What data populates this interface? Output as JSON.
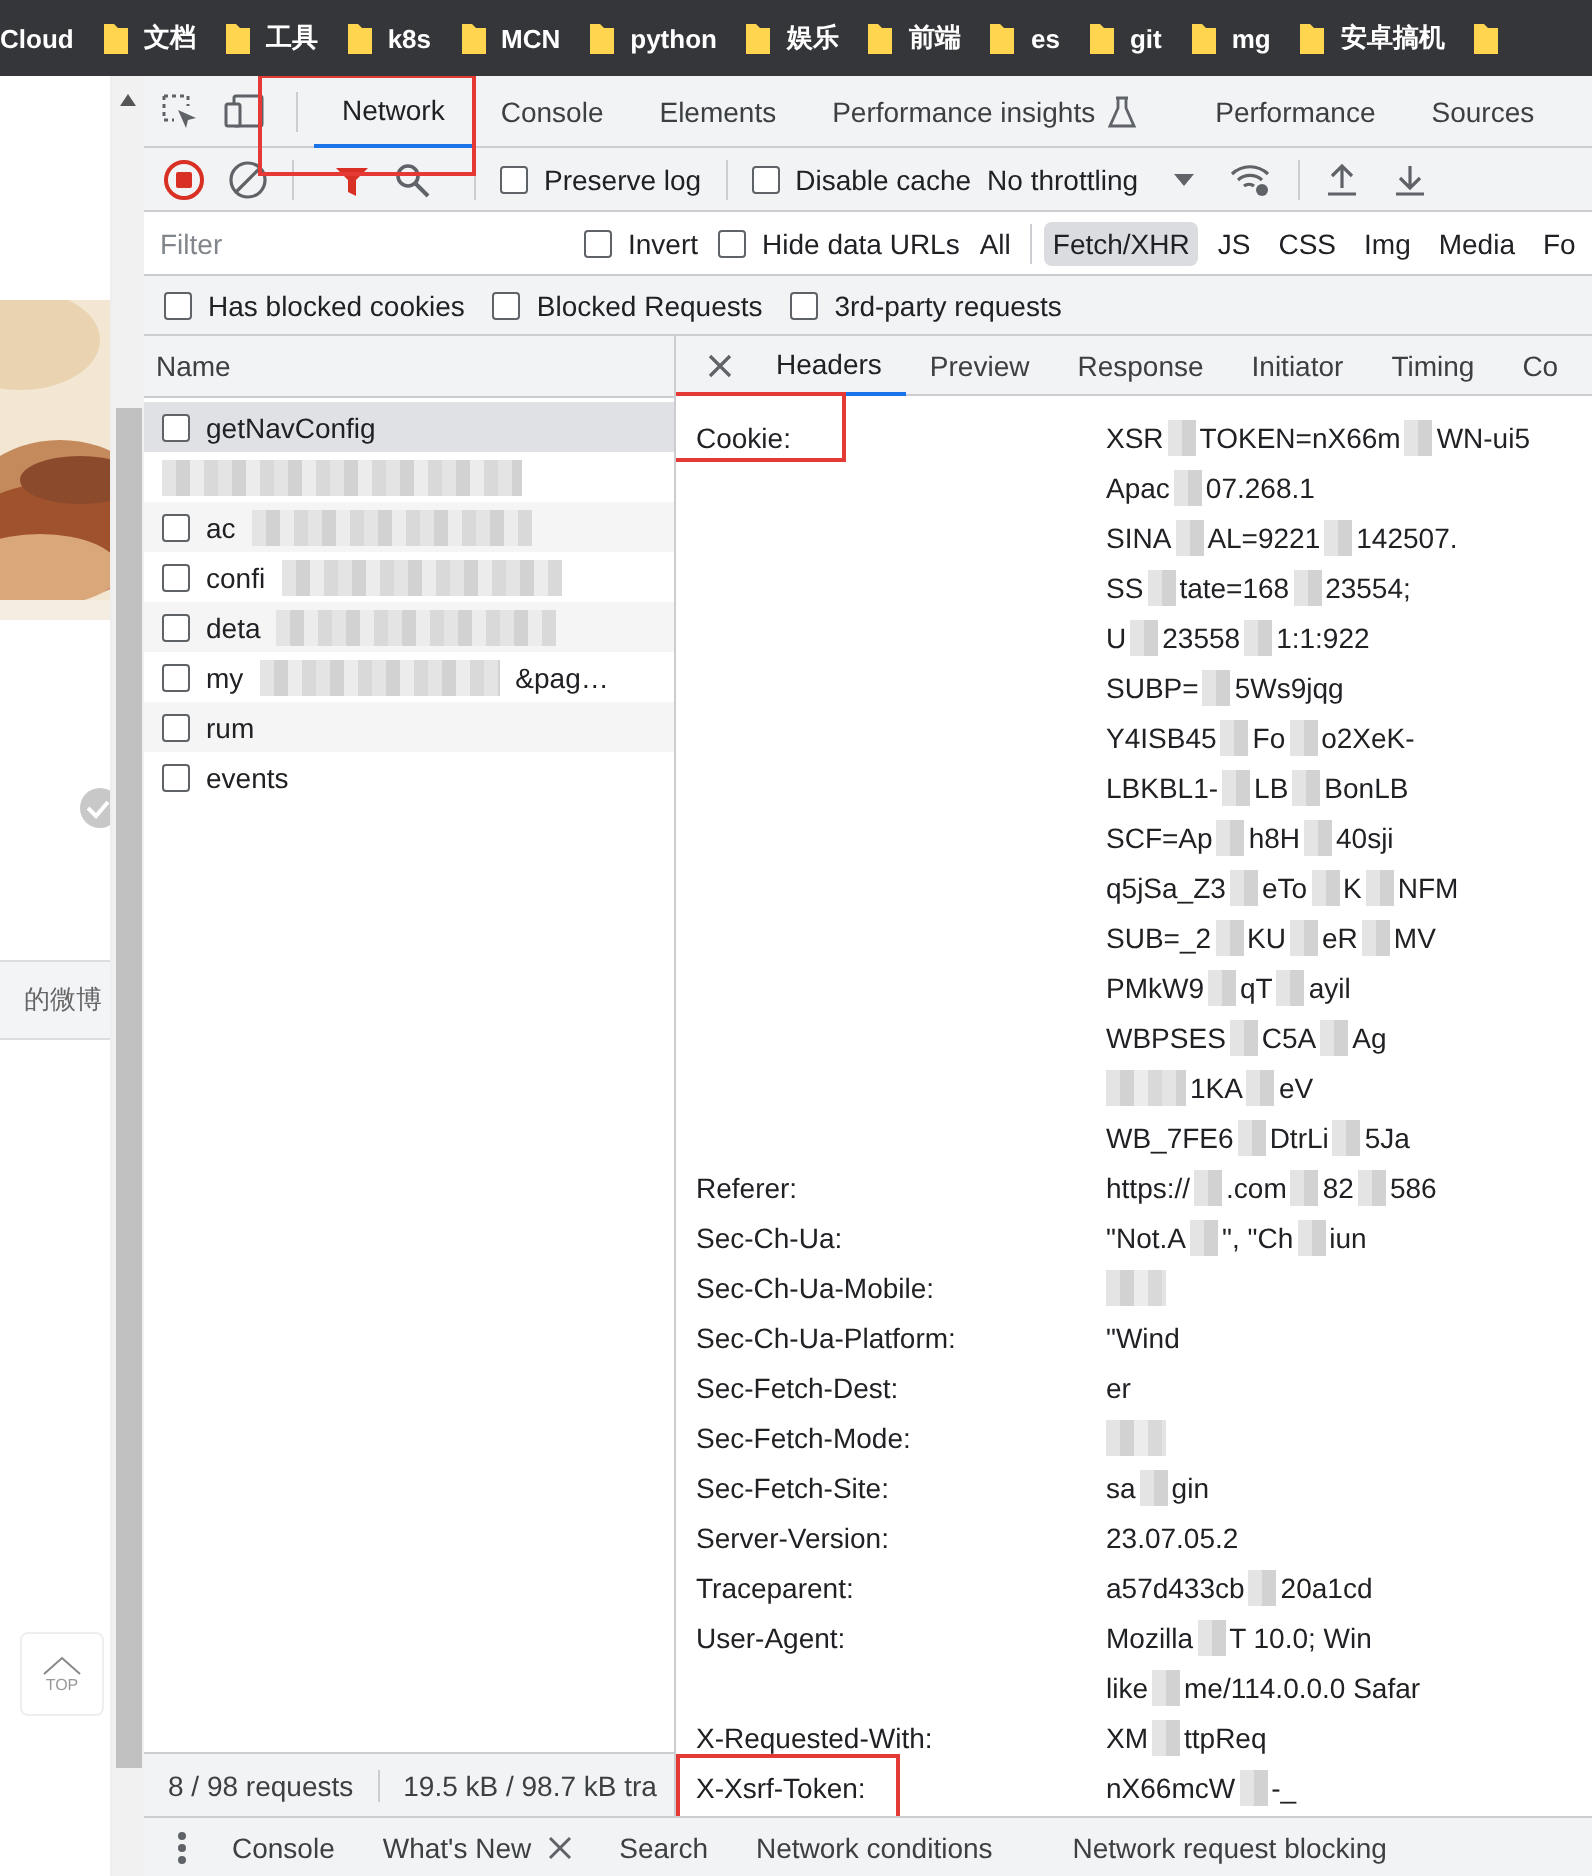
{
  "bookmarks": [
    {
      "kind": "text",
      "label": "Cloud"
    },
    {
      "kind": "folder",
      "label": "文档"
    },
    {
      "kind": "folder",
      "label": "工具"
    },
    {
      "kind": "folder",
      "label": "k8s"
    },
    {
      "kind": "folder",
      "label": "MCN"
    },
    {
      "kind": "folder",
      "label": "python"
    },
    {
      "kind": "folder",
      "label": "娱乐"
    },
    {
      "kind": "folder",
      "label": "前端"
    },
    {
      "kind": "folder",
      "label": "es"
    },
    {
      "kind": "folder",
      "label": "git"
    },
    {
      "kind": "folder",
      "label": "mg"
    },
    {
      "kind": "folder",
      "label": "安卓搞机"
    },
    {
      "kind": "folder"
    }
  ],
  "page": {
    "link": "的微博",
    "top_button": "TOP"
  },
  "devtools": {
    "tabs": [
      {
        "label": "Network",
        "selected": true,
        "highlighted": true
      },
      {
        "label": "Console",
        "selected": false,
        "highlighted": false
      },
      {
        "label": "Elements",
        "selected": false,
        "highlighted": false
      },
      {
        "label": "Performance insights",
        "selected": false,
        "highlighted": false,
        "experimental": true
      },
      {
        "label": "Performance",
        "selected": false,
        "highlighted": false
      },
      {
        "label": "Sources",
        "selected": false,
        "highlighted": false
      }
    ],
    "toolbar": {
      "recording": true,
      "filter_active": true,
      "preserve_log": {
        "label": "Preserve log",
        "checked": false
      },
      "disable_cache": {
        "label": "Disable cache",
        "checked": false
      },
      "throttling": "No throttling"
    },
    "filter": {
      "placeholder": "Filter",
      "invert": {
        "label": "Invert",
        "checked": false
      },
      "hide_data_urls": {
        "label": "Hide data URLs",
        "checked": false
      },
      "types": [
        {
          "label": "All",
          "selected": false
        },
        {
          "label": "Fetch/XHR",
          "selected": true
        },
        {
          "label": "JS",
          "selected": false
        },
        {
          "label": "CSS",
          "selected": false
        },
        {
          "label": "Img",
          "selected": false
        },
        {
          "label": "Media",
          "selected": false
        },
        {
          "label": "Fo",
          "selected": false
        }
      ]
    },
    "options": [
      {
        "label": "Has blocked cookies",
        "checked": false
      },
      {
        "label": "Blocked Requests",
        "checked": false
      },
      {
        "label": "3rd-party requests",
        "checked": false
      }
    ]
  },
  "requests": {
    "column": "Name",
    "rows": [
      {
        "parts": [
          "getNavConfig"
        ],
        "selected": true
      },
      {
        "redacted": true,
        "selected": false
      },
      {
        "parts": [
          "ac"
        ],
        "selected": false
      },
      {
        "parts": [
          "confi"
        ],
        "selected": false
      },
      {
        "parts": [
          "deta"
        ],
        "selected": false
      },
      {
        "parts": [
          "my",
          "&pag…"
        ],
        "selected": false
      },
      {
        "parts": [
          "rum"
        ],
        "selected": false
      },
      {
        "parts": [
          "events"
        ],
        "selected": false
      }
    ]
  },
  "details": {
    "tabs": [
      {
        "label": "Headers",
        "selected": true
      },
      {
        "label": "Preview",
        "selected": false
      },
      {
        "label": "Response",
        "selected": false
      },
      {
        "label": "Initiator",
        "selected": false
      },
      {
        "label": "Timing",
        "selected": false
      },
      {
        "label": "Co",
        "selected": false
      }
    ],
    "headers": [
      {
        "name": "Cookie:",
        "highlighted": true,
        "lines": [
          [
            "XSR",
            "TOKEN=nX66m",
            "WN-ui5"
          ],
          [
            "Apac",
            "07.268.1"
          ],
          [
            "SINA",
            "AL=9221",
            "142507."
          ],
          [
            "SS",
            "tate=168",
            "23554;"
          ],
          [
            "U",
            "23558",
            "1:1:922"
          ],
          [
            "SUBP=",
            "5Ws9jqg"
          ],
          [
            "Y4ISB45",
            "Fo",
            "o2XeK-"
          ],
          [
            "LBKBL1-",
            "LB",
            "BonLB"
          ],
          [
            "SCF=Ap",
            "h8H",
            "40sji"
          ],
          [
            "q5jSa_Z3",
            "eTo",
            "K",
            "NFM"
          ],
          [
            "SUB=_2",
            "KU",
            "eR",
            "MV"
          ],
          [
            "PMkW9",
            "qT",
            "ayil"
          ],
          [
            "WBPSES",
            "C5A",
            "Ag"
          ],
          [
            "1KA",
            "eV"
          ],
          [
            "WB_7FE6",
            "DtrLi",
            "5Ja"
          ]
        ]
      },
      {
        "name": "Referer:",
        "highlighted": false,
        "lines": [
          [
            "https://",
            ".com",
            "82",
            "586"
          ]
        ]
      },
      {
        "name": "Sec-Ch-Ua:",
        "highlighted": false,
        "lines": [
          [
            "\"Not.A",
            "\", \"Ch",
            "iun"
          ]
        ]
      },
      {
        "name": "Sec-Ch-Ua-Mobile:",
        "highlighted": false,
        "redacted": true
      },
      {
        "name": "Sec-Ch-Ua-Platform:",
        "highlighted": false,
        "lines": [
          [
            "\"Wind"
          ]
        ]
      },
      {
        "name": "Sec-Fetch-Dest:",
        "highlighted": false,
        "lines": [
          [
            "er"
          ]
        ]
      },
      {
        "name": "Sec-Fetch-Mode:",
        "highlighted": false,
        "redacted": true
      },
      {
        "name": "Sec-Fetch-Site:",
        "highlighted": false,
        "lines": [
          [
            "sa",
            "gin"
          ]
        ]
      },
      {
        "name": "Server-Version:",
        "highlighted": false,
        "lines": [
          [
            "23.07.05.2"
          ]
        ]
      },
      {
        "name": "Traceparent:",
        "highlighted": false,
        "lines": [
          [
            "a57d433cb",
            "20a1cd"
          ]
        ]
      },
      {
        "name": "User-Agent:",
        "highlighted": false,
        "lines": [
          [
            "Mozilla",
            "T 10.0; Win"
          ],
          [
            "like",
            "me/114.0.0.0 Safar"
          ]
        ]
      },
      {
        "name": "X-Requested-With:",
        "highlighted": false,
        "lines": [
          [
            "XM",
            "ttpReq"
          ]
        ]
      },
      {
        "name": "X-Xsrf-Token:",
        "highlighted": true,
        "lines": [
          [
            "nX66mcW",
            "-_"
          ]
        ]
      }
    ]
  },
  "status": {
    "requests": "8 / 98 requests",
    "transferred": "19.5 kB / 98.7 kB tra"
  },
  "drawer": {
    "tabs": [
      {
        "label": "Console",
        "closable": false
      },
      {
        "label": "What's New",
        "closable": true
      },
      {
        "label": "Search",
        "closable": false
      },
      {
        "label": "Network conditions",
        "closable": false
      },
      {
        "label": "Network request blocking",
        "closable": false
      }
    ]
  }
}
